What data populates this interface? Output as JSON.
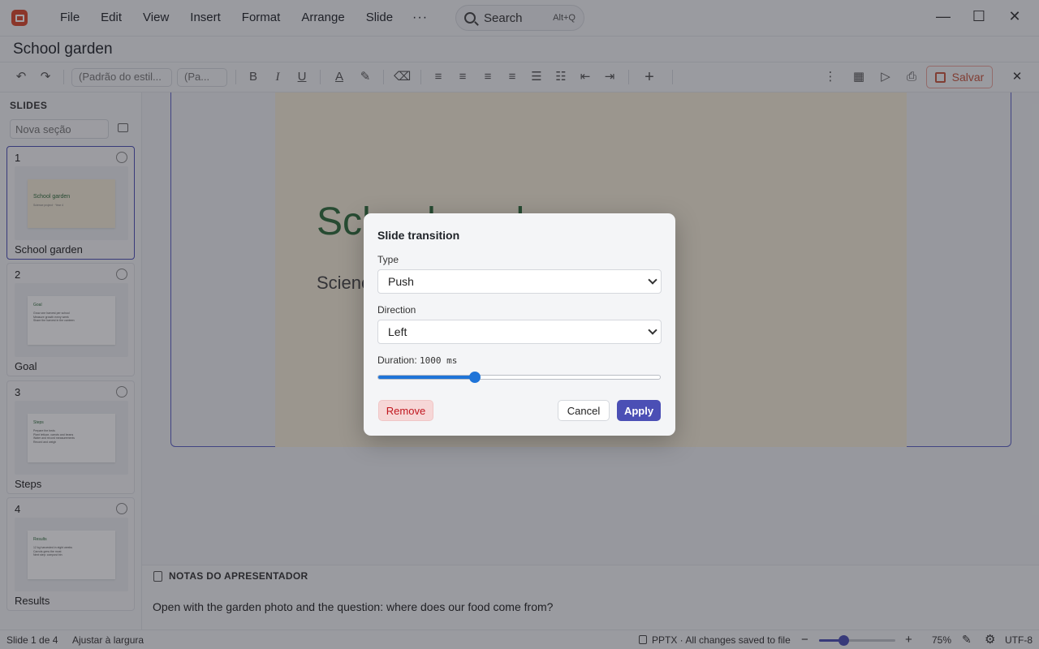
{
  "menubar": {
    "app_icon": "presentation-app-icon",
    "items": [
      "File",
      "Edit",
      "View",
      "Insert",
      "Format",
      "Arrange",
      "Slide"
    ],
    "more_label": "···",
    "search": {
      "label": "Search",
      "shortcut": "Alt+Q"
    },
    "window_controls": {
      "minimize": "—",
      "maximize": "☐",
      "close": "✕"
    }
  },
  "document": {
    "title": "School garden"
  },
  "toolbar": {
    "undo": "↶",
    "redo": "↷",
    "style_select": "(Padrão do estil...",
    "size_select": "(Pa...",
    "bold": "B",
    "italic": "I",
    "underline": "U",
    "font_color": "A",
    "highlight": "✎",
    "clear_format": "⌫",
    "align_left": "≡",
    "align_center": "≡",
    "align_right": "≡",
    "justify": "≡",
    "bullets": "☰",
    "numbered": "☷",
    "outdent": "⇤",
    "indent": "⇥",
    "insert": "+",
    "more": "⋮",
    "table": "▦",
    "present": "▷",
    "print": "⎙",
    "save_label": "Salvar",
    "close": "✕"
  },
  "sidebar": {
    "heading": "SLIDES",
    "section_placeholder": "Nova seção",
    "slides": [
      {
        "num": "1",
        "caption": "School garden",
        "thumb_title": "School garden",
        "thumb_sub": "Science project · Year 4",
        "active": true
      },
      {
        "num": "2",
        "caption": "Goal",
        "thumb_title": "Goal",
        "thumb_lines": [
          "Grow one harvest per school",
          "Measure growth every week",
          "Share the harvest in the canteen"
        ]
      },
      {
        "num": "3",
        "caption": "Steps",
        "thumb_title": "Steps",
        "thumb_lines": [
          "Prepare the beds",
          "Plant lettuce, carrots and beans",
          "Water and record measurements",
          "Record and weigh"
        ]
      },
      {
        "num": "4",
        "caption": "Results",
        "thumb_title": "Results",
        "thumb_lines": [
          "12 kg harvested in eight weeks",
          "Carrots grew the most",
          "Next step: compost bin"
        ]
      }
    ]
  },
  "slide": {
    "title": "School garden",
    "subtitle": "Science project · Year 4"
  },
  "notes": {
    "heading": "NOTAS DO APRESENTADOR",
    "text": "Open with the garden photo and the question: where does our food come from?"
  },
  "statusbar": {
    "slide_pos": "Slide 1 de 4",
    "fit": "Ajustar à largura",
    "save_status": "PPTX · All changes saved to file",
    "zoom_minus": "−",
    "zoom_plus": "+",
    "zoom": "75%",
    "zoom_fraction": 0.32,
    "encoding": "UTF-8"
  },
  "dialog": {
    "title": "Slide transition",
    "type_label": "Type",
    "type_value": "Push",
    "direction_label": "Direction",
    "direction_value": "Left",
    "duration_label": "Duration:",
    "duration_value": "1000 ms",
    "duration_fraction": 0.34,
    "remove_label": "Remove",
    "cancel_label": "Cancel",
    "apply_label": "Apply"
  },
  "colors": {
    "accent": "#4b4fb5",
    "app_red": "#d9482b",
    "slide_title_green": "#2d6b3a",
    "slide_bg": "#f5ecd8",
    "danger": "#c0161e"
  }
}
